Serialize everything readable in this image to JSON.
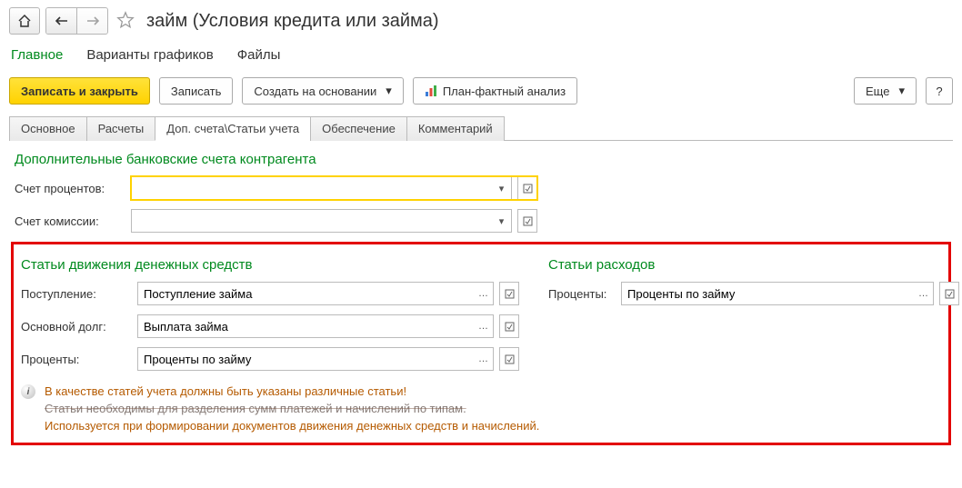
{
  "header": {
    "title": "займ (Условия кредита или займа)"
  },
  "main_tabs": {
    "items": [
      {
        "label": "Главное",
        "active": true
      },
      {
        "label": "Варианты графиков",
        "active": false
      },
      {
        "label": "Файлы",
        "active": false
      }
    ]
  },
  "toolbar": {
    "save_close": "Записать и закрыть",
    "save": "Записать",
    "create_based": "Создать на основании",
    "plan_fact": "План-фактный анализ",
    "more": "Еще",
    "help": "?"
  },
  "sub_tabs": {
    "items": [
      {
        "label": "Основное",
        "active": false
      },
      {
        "label": "Расчеты",
        "active": false
      },
      {
        "label": "Доп. счета\\Статьи учета",
        "active": true
      },
      {
        "label": "Обеспечение",
        "active": false
      },
      {
        "label": "Комментарий",
        "active": false
      }
    ]
  },
  "sections": {
    "bank_accounts_title": "Дополнительные банковские счета контрагента",
    "interest_account_label": "Счет процентов:",
    "interest_account_value": "",
    "commission_account_label": "Счет комиссии:",
    "commission_account_value": "",
    "cashflow_title": "Статьи движения денежных средств",
    "expenses_title": "Статьи расходов",
    "incoming_label": "Поступление:",
    "incoming_value": "Поступление займа",
    "principal_label": "Основной долг:",
    "principal_value": "Выплата займа",
    "interest_label": "Проценты:",
    "interest_value": "Проценты по займу",
    "exp_interest_label": "Проценты:",
    "exp_interest_value": "Проценты по займу",
    "warning1": "В качестве статей учета должны быть указаны различные статьи!",
    "warning2_strike": "Статьи необходимы для разделения сумм платежей и начислений по типам.",
    "warning3": "Используется при формировании документов движения денежных средств и начислений."
  },
  "icons": {
    "dropdown": "▾",
    "open": "☐",
    "ellipsis": "…"
  }
}
